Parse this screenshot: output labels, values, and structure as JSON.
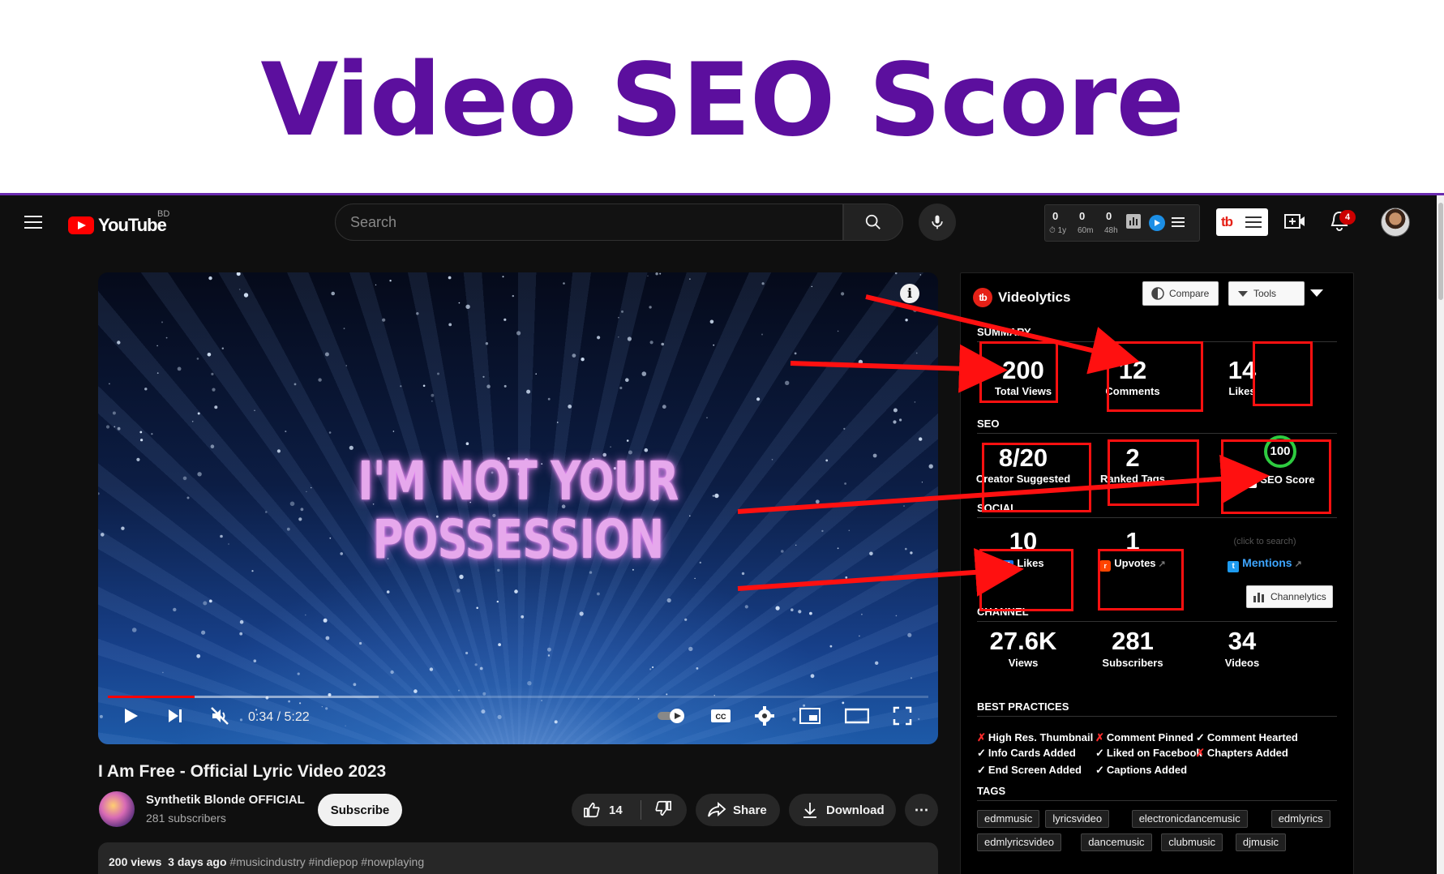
{
  "banner": {
    "title": "Video SEO Score"
  },
  "masthead": {
    "logo_text": "YouTube",
    "country_code": "BD",
    "search_placeholder": "Search",
    "counter": {
      "values": [
        "0",
        "0",
        "0"
      ],
      "labels": [
        "1y",
        "60m",
        "48h"
      ],
      "colors": [
        "#f5a623",
        "#4a90e2",
        "#4a90e2"
      ]
    },
    "tb_logo": "tb",
    "notification_count": "4"
  },
  "player": {
    "lyric_line1": "I'M NOT YOUR",
    "lyric_line2": "POSSESSION",
    "time": "0:34 / 5:22",
    "progress_played": 0.106,
    "progress_buffered": 0.33
  },
  "video": {
    "title": "I Am Free - Official Lyric Video 2023",
    "channel_name": "Synthetik Blonde OFFICIAL",
    "channel_subs": "281 subscribers",
    "subscribe_label": "Subscribe",
    "like_count": "14",
    "share_label": "Share",
    "download_label": "Download",
    "more_label": "⋯",
    "desc_meta": "200 views  3 days ago",
    "desc_tags": "#musicindustry #indiepop #nowplaying"
  },
  "videolytics": {
    "brand": "Videolytics",
    "compare_label": "Compare",
    "tools_label": "Tools",
    "summary": {
      "section": "SUMMARY",
      "views": "200",
      "views_label": "Total Views",
      "comments": "12",
      "comments_label": "Comments",
      "likes": "14",
      "likes_label": "Likes"
    },
    "seo": {
      "section": "SEO",
      "creator_suggested": "8/20",
      "creator_suggested_label": "Creator Suggested",
      "ranked_tags": "2",
      "ranked_tags_label": "Ranked Tags",
      "score": "100",
      "score_label": "SEO Score"
    },
    "social": {
      "section": "SOCIAL",
      "fb_likes": "10",
      "fb_likes_label": "Likes",
      "upvotes": "1",
      "upvotes_label": "Upvotes",
      "click_hint": "(click to search)",
      "mentions_label": "Mentions"
    },
    "channel": {
      "section": "CHANNEL",
      "channelytics_label": "Channelytics",
      "views": "27.6K",
      "views_label": "Views",
      "subscribers": "281",
      "subscribers_label": "Subscribers",
      "videos": "34",
      "videos_label": "Videos"
    },
    "best_practices": {
      "section": "BEST PRACTICES",
      "items": [
        {
          "ok": false,
          "label": "High Res. Thumbnail"
        },
        {
          "ok": false,
          "label": "Comment Pinned"
        },
        {
          "ok": true,
          "label": "Comment Hearted"
        },
        {
          "ok": true,
          "label": "Info Cards Added"
        },
        {
          "ok": true,
          "label": "Liked on Facebook"
        },
        {
          "ok": false,
          "label": "Chapters Added"
        },
        {
          "ok": true,
          "label": "End Screen Added"
        },
        {
          "ok": true,
          "label": "Captions Added"
        }
      ]
    },
    "tags": {
      "section": "TAGS",
      "items": [
        "edmmusic",
        "lyricsvideo",
        "electronicdancemusic",
        "edmlyrics",
        "edmlyricsvideo",
        "dancemusic",
        "clubmusic",
        "djmusic"
      ]
    }
  },
  "colors": {
    "banner_title": "#5c0f9e",
    "annotation_red": "#ff1010",
    "score_ring": "#2ecc40"
  }
}
